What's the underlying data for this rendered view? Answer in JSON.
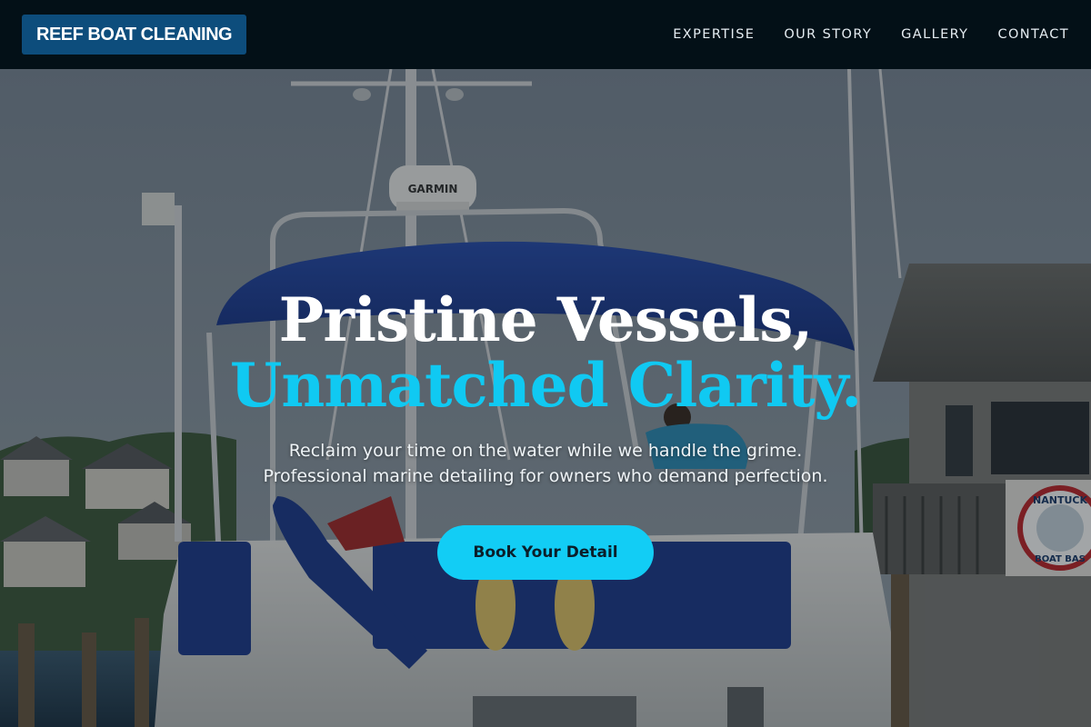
{
  "nav": {
    "logo": "REEF BOAT CLEANING",
    "links": [
      "EXPERTISE",
      "OUR STORY",
      "GALLERY",
      "CONTACT"
    ]
  },
  "hero": {
    "headline_line1": "Pristine Vessels,",
    "headline_line2": "Unmatched Clarity.",
    "subtext_line1": "Reclaim your time on the water while we handle the grime.",
    "subtext_line2": "Professional marine detailing for owners who demand perfection.",
    "cta_label": "Book Your Detail",
    "radar_brand": "GARMIN",
    "sign_text_top": "NANTUCK",
    "sign_text_bottom": "BOAT BAS"
  },
  "colors": {
    "nav_background": "#031017",
    "logo_background": "#0d4d7c",
    "accent_cyan": "#10c9f2",
    "canvas_blue": "#1f3d8f"
  }
}
